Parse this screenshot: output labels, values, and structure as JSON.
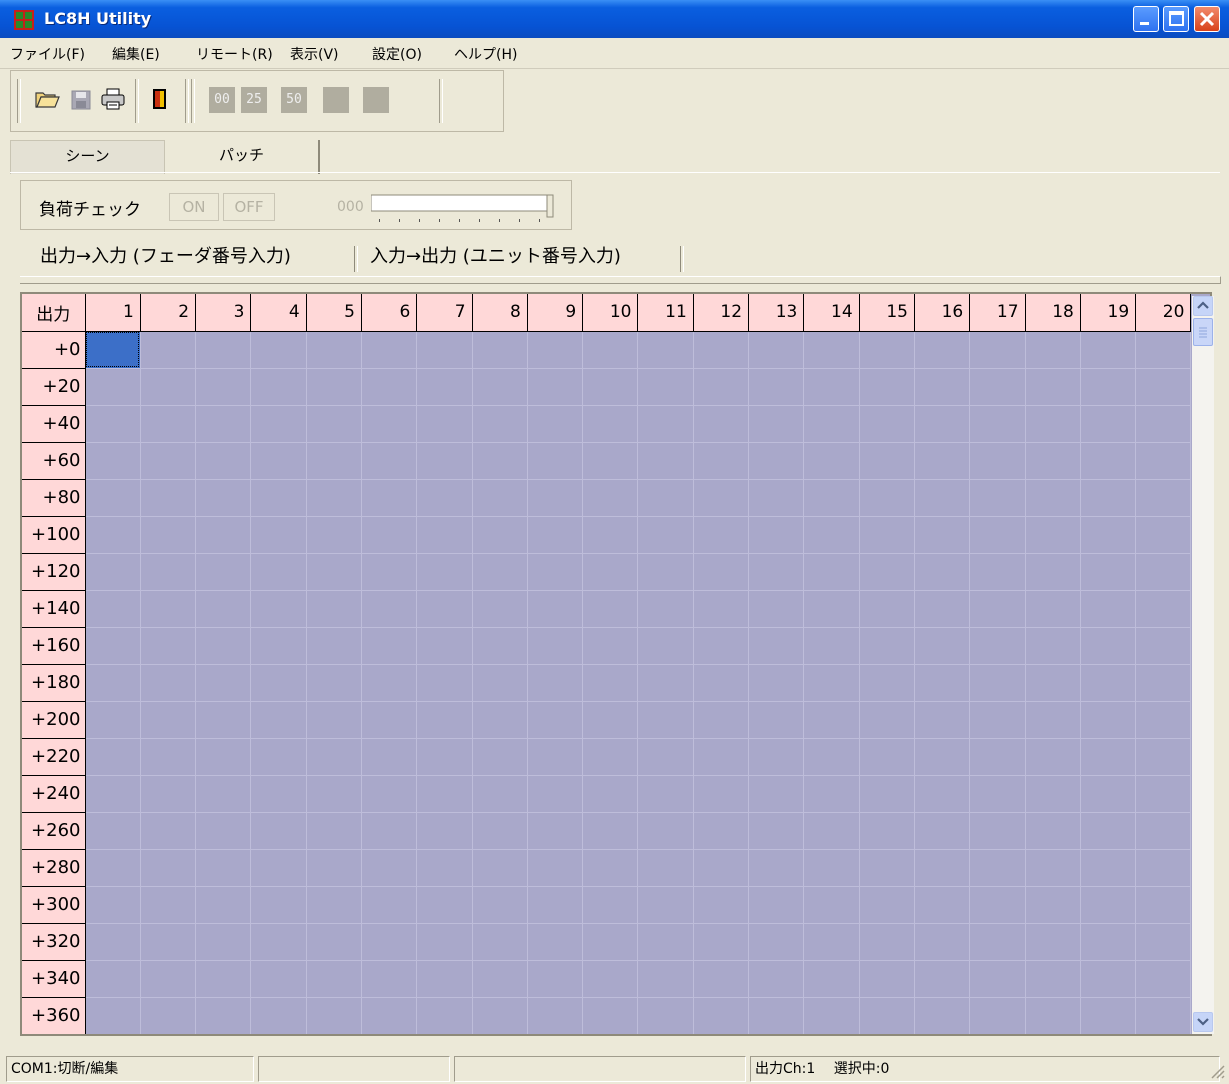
{
  "window": {
    "title": "LC8H Utility"
  },
  "menu": [
    "ファイル(F)",
    "編集(E)",
    "リモート(R)",
    "表示(V)",
    "設定(O)",
    "ヘルプ(H)"
  ],
  "toolbar": {
    "icons": [
      "open-folder-icon",
      "save-disk-icon",
      "print-icon",
      "exit-door-icon"
    ],
    "counters": [
      "00",
      "25",
      "50",
      "",
      ""
    ]
  },
  "tabs": {
    "scene": "シーン",
    "patch": "パッチ"
  },
  "load_check": {
    "label": "負荷チェック",
    "on": "ON",
    "off": "OFF",
    "value": "000"
  },
  "subtabs": {
    "out_to_in": "出力→入力 (フェーダ番号入力)",
    "in_to_out": "入力→出力 (ユニット番号入力)"
  },
  "grid": {
    "corner": "出力",
    "columns": [
      "1",
      "2",
      "3",
      "4",
      "5",
      "6",
      "7",
      "8",
      "9",
      "10",
      "11",
      "12",
      "13",
      "14",
      "15",
      "16",
      "17",
      "18",
      "19",
      "20"
    ],
    "rows": [
      "+0",
      "+20",
      "+40",
      "+60",
      "+80",
      "+100",
      "+120",
      "+140",
      "+160",
      "+180",
      "+200",
      "+220",
      "+240",
      "+260",
      "+280",
      "+300",
      "+320",
      "+340",
      "+360"
    ],
    "selected": {
      "row": 0,
      "col": 0
    }
  },
  "status": {
    "connection": "COM1:切断/編集",
    "pane2": "",
    "pane3": "",
    "output_ch": "出力Ch:1",
    "selected": "選択中:0"
  },
  "colors": {
    "grid_bg": "#a9a8ca",
    "header_bg": "#ffd8d8",
    "selected_cell": "#3c6fc8",
    "titlebar": "#0a5fe0"
  }
}
